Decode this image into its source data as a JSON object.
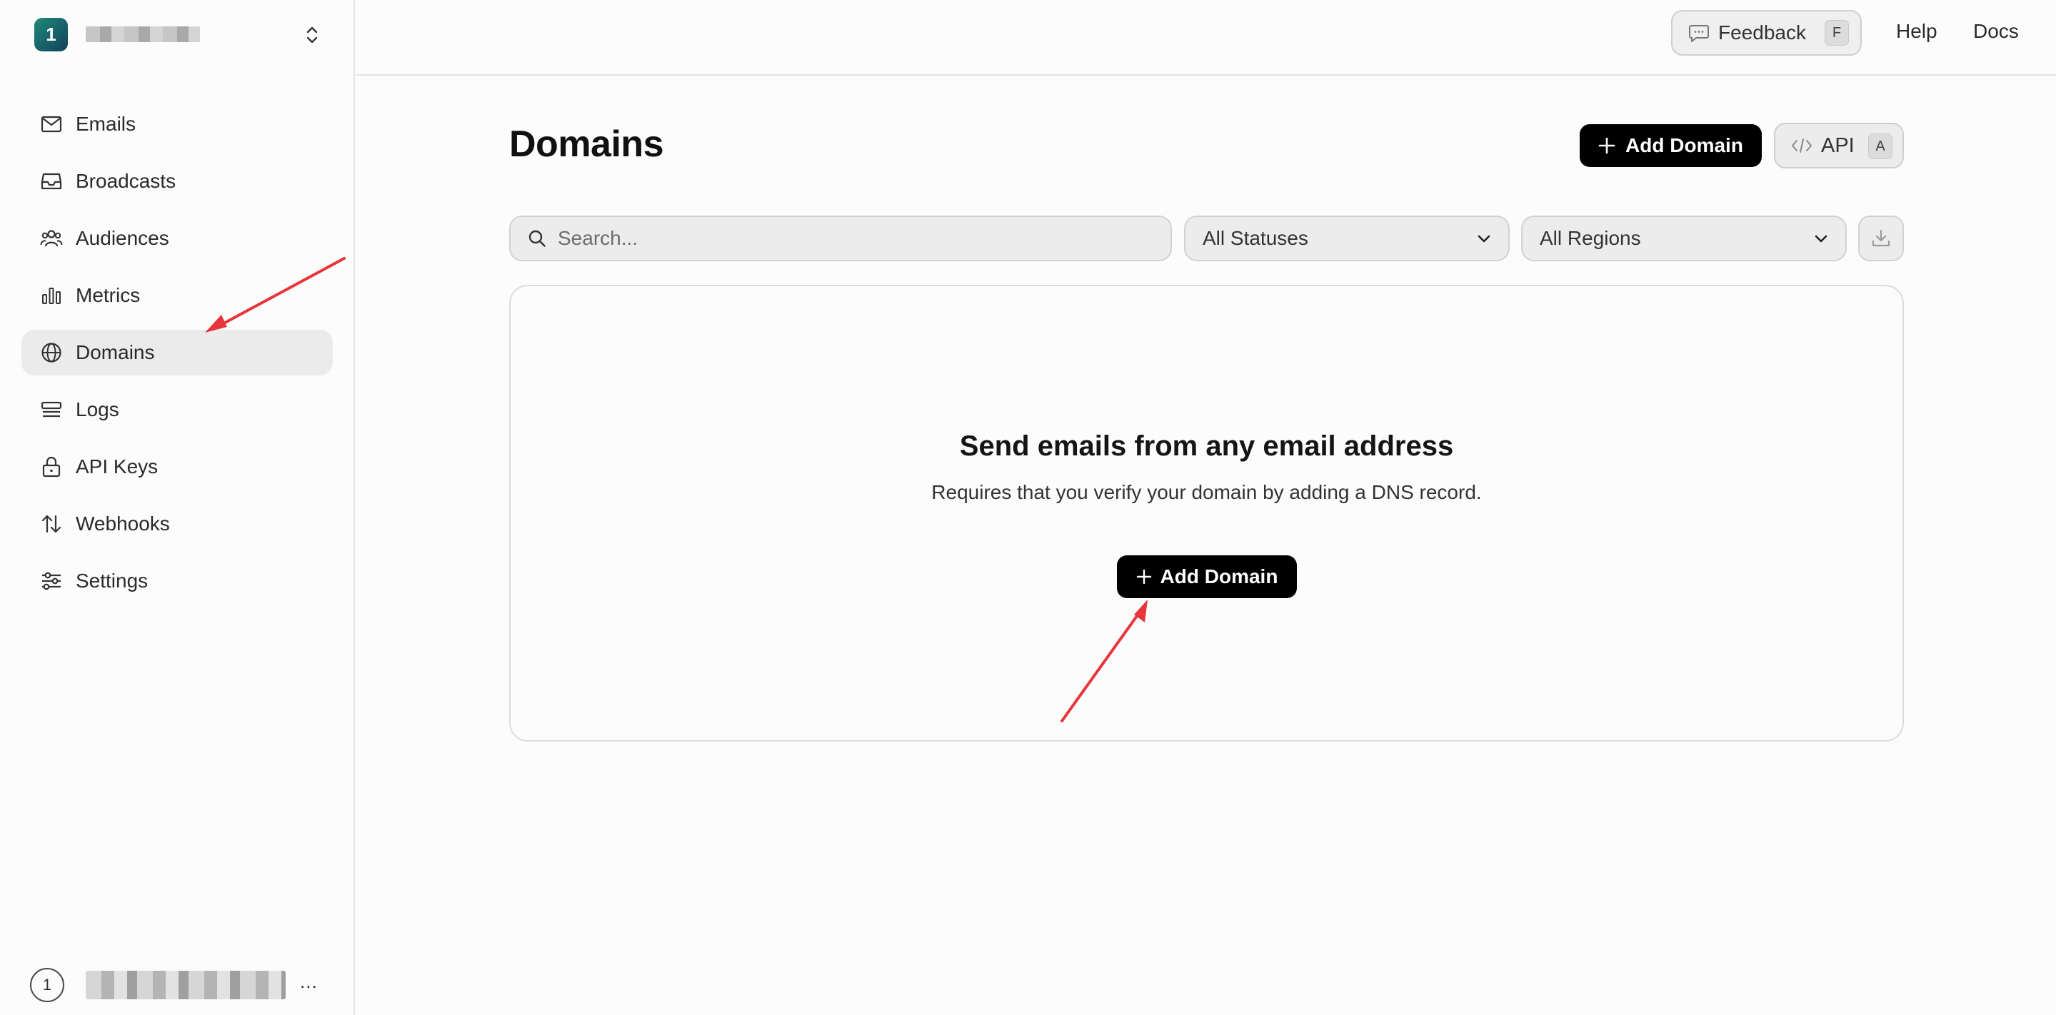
{
  "team": {
    "badge": "1"
  },
  "sidebar": {
    "items": [
      {
        "label": "Emails",
        "icon": "mail-icon",
        "active": false
      },
      {
        "label": "Broadcasts",
        "icon": "inbox-icon",
        "active": false
      },
      {
        "label": "Audiences",
        "icon": "users-icon",
        "active": false
      },
      {
        "label": "Metrics",
        "icon": "bar-chart-icon",
        "active": false
      },
      {
        "label": "Domains",
        "icon": "globe-icon",
        "active": true
      },
      {
        "label": "Logs",
        "icon": "logs-icon",
        "active": false
      },
      {
        "label": "API Keys",
        "icon": "lock-icon",
        "active": false
      },
      {
        "label": "Webhooks",
        "icon": "arrows-up-down-icon",
        "active": false
      },
      {
        "label": "Settings",
        "icon": "sliders-icon",
        "active": false
      }
    ]
  },
  "user": {
    "avatar": "1",
    "more": "..."
  },
  "header": {
    "feedback_label": "Feedback",
    "feedback_key": "F",
    "help_label": "Help",
    "docs_label": "Docs"
  },
  "main": {
    "title": "Domains",
    "add_domain_label": "Add Domain",
    "api_label": "API",
    "api_key": "A",
    "search_placeholder": "Search...",
    "status_filter": "All Statuses",
    "region_filter": "All Regions",
    "empty_state": {
      "title": "Send emails from any email address",
      "subtitle": "Requires that you verify your domain by adding a DNS record.",
      "button_label": "Add Domain"
    }
  },
  "colors": {
    "accent": "#000000",
    "annotation_arrow": "#e8353b",
    "active_nav_bg": "#ebebeb"
  }
}
